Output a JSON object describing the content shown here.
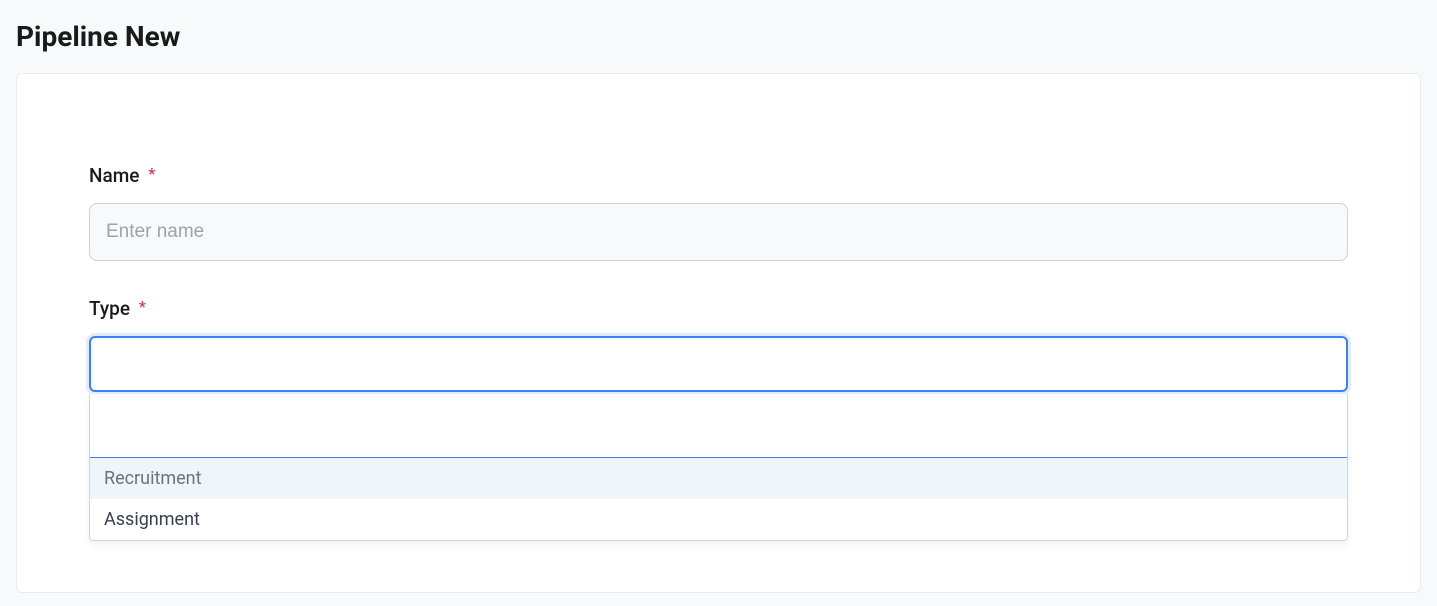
{
  "page": {
    "title": "Pipeline New"
  },
  "form": {
    "name": {
      "label": "Name",
      "placeholder": "Enter name",
      "value": ""
    },
    "type": {
      "label": "Type",
      "value": "",
      "options": [
        {
          "label": "Recruitment"
        },
        {
          "label": "Assignment"
        }
      ]
    }
  }
}
